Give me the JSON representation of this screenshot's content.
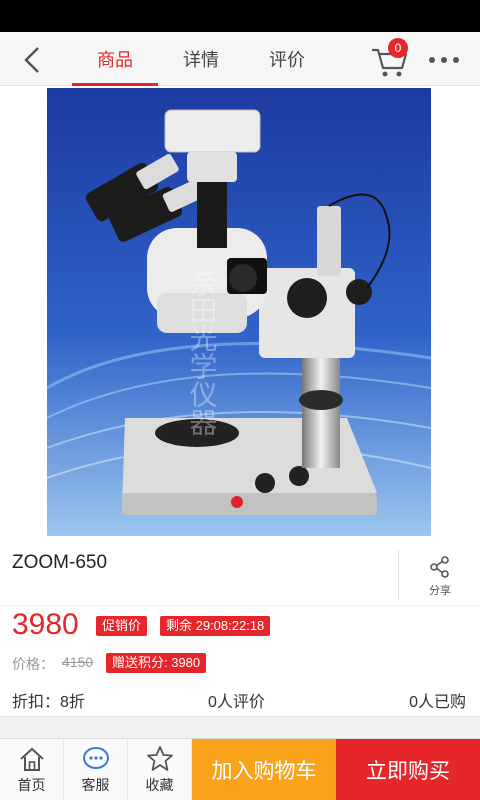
{
  "header": {
    "tabs": [
      {
        "label": "商品",
        "active": true
      },
      {
        "label": "详情",
        "active": false
      },
      {
        "label": "评价",
        "active": false
      }
    ],
    "cart_count": "0",
    "accent_color": "#e5262a"
  },
  "product": {
    "image_watermark": "奈田光学仪器",
    "title": "ZOOM-650",
    "share_label": "分享",
    "price": "3980",
    "promo_tag": "促销价",
    "remaining": "剩余  29:08:22:18",
    "original_price_label": "价格：",
    "original_price": "4150",
    "points": "赠送积分: 3980",
    "discount": "折扣：8折",
    "reviews": "0人评价",
    "buyers": "0人已购"
  },
  "bottom_nav": {
    "home_label": "首页",
    "service_label": "客服",
    "favorite_label": "收藏",
    "add_to_cart_label": "加入购物车",
    "buy_now_label": "立即购买",
    "cart_button_color": "#f9a21c",
    "buy_button_color": "#e5262a"
  }
}
